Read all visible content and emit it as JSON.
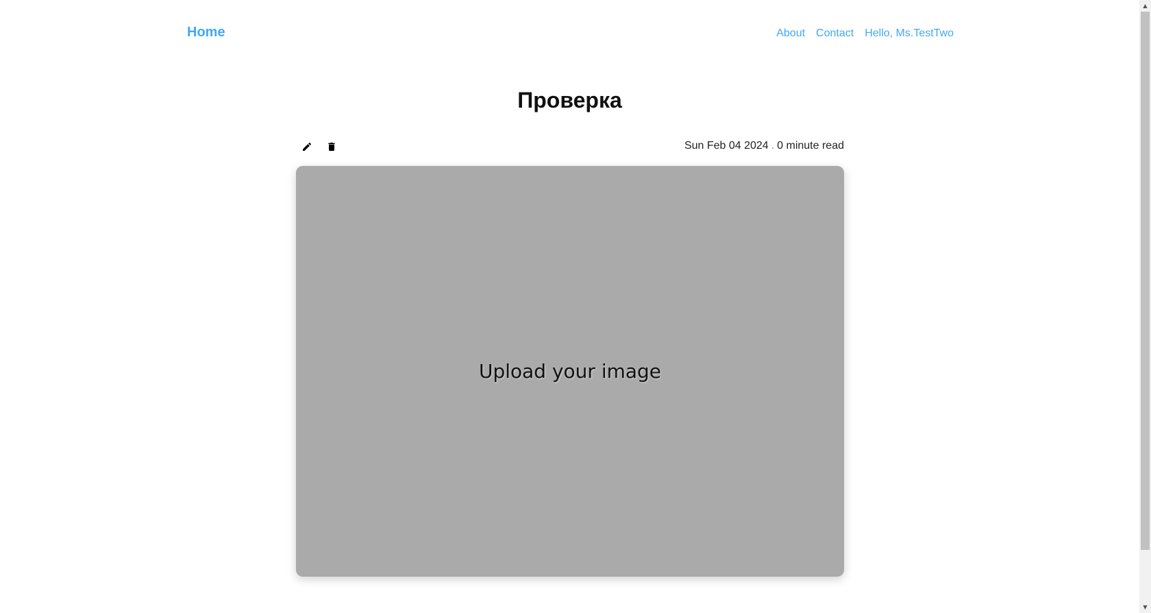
{
  "nav": {
    "home_label": "Home",
    "links": [
      {
        "label": "About"
      },
      {
        "label": "Contact"
      },
      {
        "label": "Hello, Ms.TestTwo"
      }
    ]
  },
  "post": {
    "title": "Проверка",
    "date": "Sun Feb 04 2024",
    "separator": ".",
    "read_time": "0 minute read",
    "image_placeholder": "Upload your image"
  },
  "icons": {
    "edit": "pencil-icon",
    "delete": "trash-icon"
  },
  "colors": {
    "link": "#3fa9f5",
    "placeholder_bg": "#aaaaaa"
  }
}
